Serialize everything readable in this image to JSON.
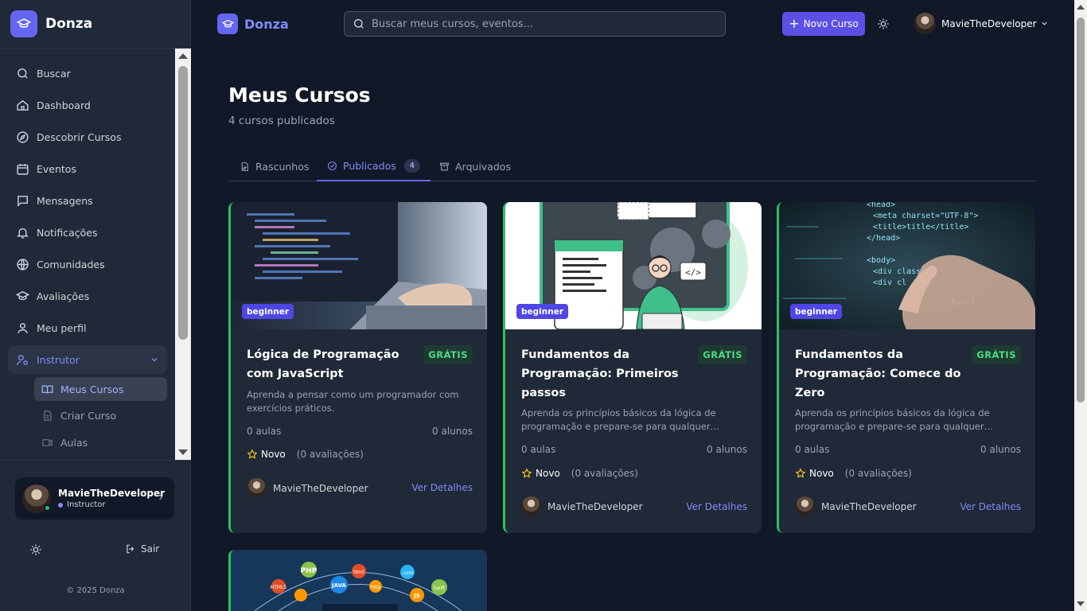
{
  "app": {
    "name": "Donza"
  },
  "sidebar": {
    "items": [
      {
        "label": "Buscar"
      },
      {
        "label": "Dashboard"
      },
      {
        "label": "Descobrir Cursos"
      },
      {
        "label": "Eventos"
      },
      {
        "label": "Mensagens"
      },
      {
        "label": "Notificações"
      },
      {
        "label": "Comunidades"
      },
      {
        "label": "Avaliações"
      },
      {
        "label": "Meu perfil"
      },
      {
        "label": "Instrutor"
      }
    ],
    "sub_items": [
      {
        "label": "Meus Cursos"
      },
      {
        "label": "Criar Curso"
      },
      {
        "label": "Aulas"
      }
    ],
    "user": {
      "name": "MavieTheDeveloper",
      "role": "Instructor"
    },
    "logout_label": "Sair",
    "copyright": "© 2025 Donza"
  },
  "topbar": {
    "brand": "Donza",
    "search_placeholder": "Buscar meus cursos, eventos...",
    "new_course_label": "Novo Curso",
    "user_name": "MavieTheDeveloper"
  },
  "page": {
    "title": "Meus Cursos",
    "subtitle": "4 cursos publicados"
  },
  "tabs": [
    {
      "label": "Rascunhos"
    },
    {
      "label": "Publicados",
      "count": "4"
    },
    {
      "label": "Arquivados"
    }
  ],
  "courses": [
    {
      "level": "beginner",
      "title": "Lógica de Programação com JavaScript",
      "price": "GRÁTIS",
      "description": "Aprenda a pensar como um programador com exercícios práticos.",
      "lessons": "0 aulas",
      "students": "0 alunos",
      "rating_label": "Novo",
      "reviews": "(0 avaliações)",
      "author": "MavieTheDeveloper",
      "details_label": "Ver Detalhes"
    },
    {
      "level": "beginner",
      "title": "Fundamentos da Programação: Primeiros passos",
      "price": "GRÁTIS",
      "description": "Aprenda os princípios básicos da lógica de programação e prepare-se para qualquer…",
      "lessons": "0 aulas",
      "students": "0 alunos",
      "rating_label": "Novo",
      "reviews": "(0 avaliações)",
      "author": "MavieTheDeveloper",
      "details_label": "Ver Detalhes"
    },
    {
      "level": "beginner",
      "title": "Fundamentos da Programação: Comece do Zero",
      "price": "GRÁTIS",
      "description": "Aprenda os princípios básicos da lógica de programação e prepare-se para qualquer…",
      "lessons": "0 aulas",
      "students": "0 alunos",
      "rating_label": "Novo",
      "reviews": "(0 avaliações)",
      "author": "MavieTheDeveloper",
      "details_label": "Ver Detalhes"
    }
  ],
  "card4_tags": [
    "PHP",
    "HTML5",
    "html",
    "JAVA",
    "http",
    ".com",
    "JS",
    "Swift",
    "HTML5"
  ],
  "card3_code": [
    "<head>",
    "<meta charset=\"UTF-8\">",
    "<title>title</title>",
    "</head>",
    "<body>",
    "<div class",
    "<div cl",
    "[...]"
  ],
  "colors": {
    "accent": "#6366f1",
    "success": "#22c55e",
    "background": "#111827",
    "surface": "#1f2937"
  }
}
